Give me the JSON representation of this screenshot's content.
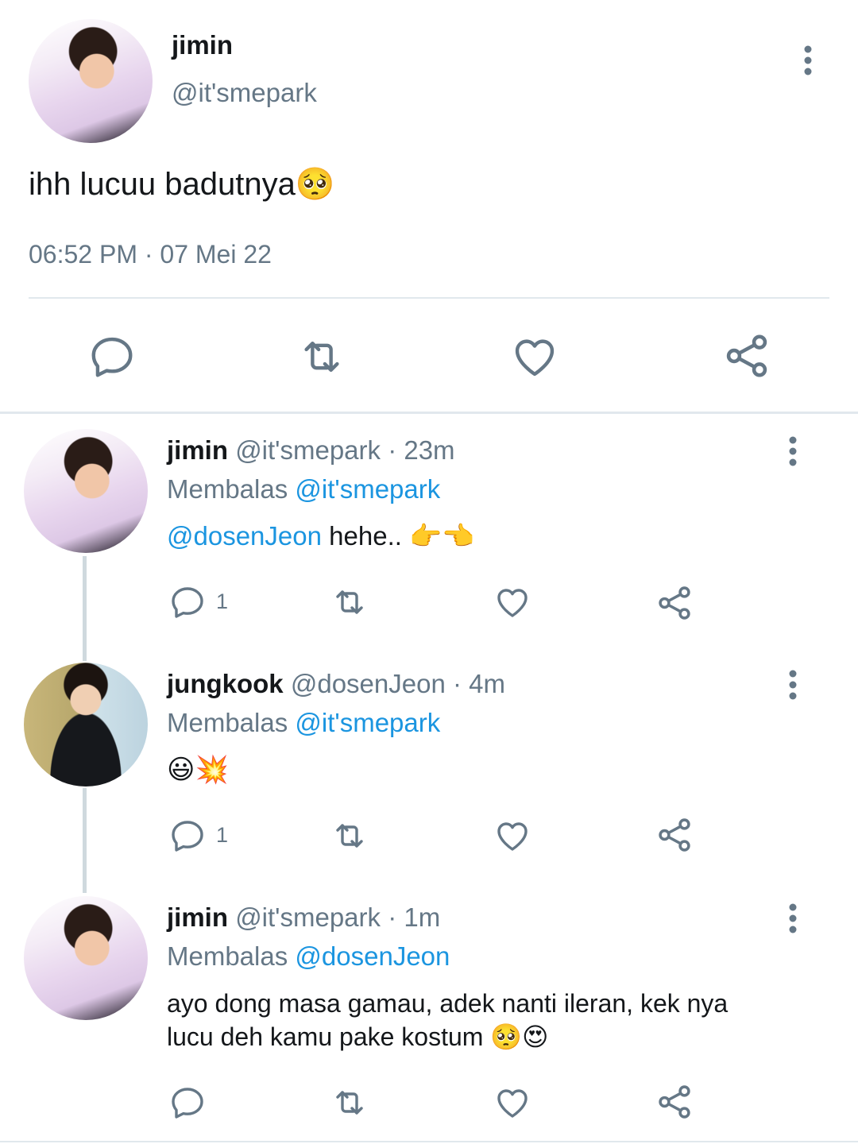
{
  "main_tweet": {
    "name": "jimin",
    "handle": "@it'smepark",
    "text": "ihh lucuu badutnya",
    "text_emoji": "🥺",
    "timestamp": "06:52 PM · 07 Mei 22"
  },
  "replies": [
    {
      "name": "jimin",
      "handle_time": "@it'smepark · 23m",
      "replying_label": "Membalas",
      "replying_to": "@it'smepark",
      "mention": "@dosenJeon",
      "text": "hehe..",
      "emoji": "👉👈",
      "reply_count": "1"
    },
    {
      "name": "jungkook",
      "handle_time": "@dosenJeon · 4m",
      "replying_label": "Membalas",
      "replying_to": "@it'smepark",
      "emoji": "😃💥",
      "reply_count": "1"
    },
    {
      "name": "jimin",
      "handle_time": "@it'smepark · 1m",
      "replying_label": "Membalas",
      "replying_to": "@dosenJeon",
      "text_line1": "ayo dong masa gamau, adek nanti ileran, kek nya",
      "text_line2": "lucu deh kamu pake kostum",
      "emoji": "🥺😍"
    }
  ],
  "icons": {
    "reply": "reply-icon",
    "retweet": "retweet-icon",
    "like": "heart-icon",
    "share": "share-icon",
    "more": "more-vertical-icon"
  },
  "colors": {
    "link": "#1b95e0",
    "muted": "#657786",
    "icon": "#657786"
  }
}
